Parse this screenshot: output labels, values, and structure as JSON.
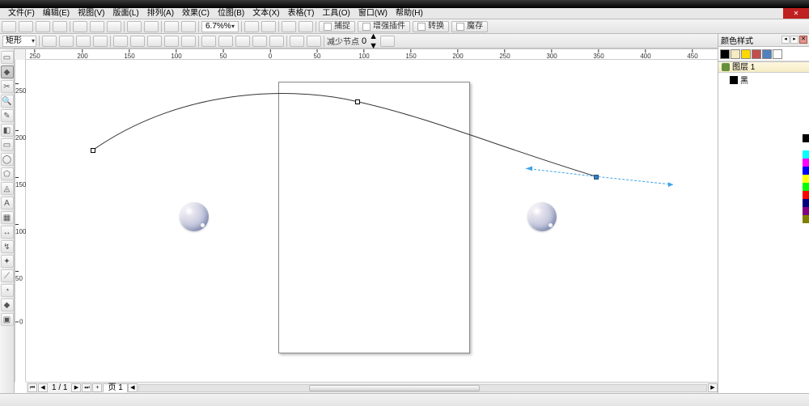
{
  "menu": {
    "items": [
      "文件(F)",
      "编辑(E)",
      "视图(V)",
      "版面(L)",
      "排列(A)",
      "效果(C)",
      "位图(B)",
      "文本(X)",
      "表格(T)",
      "工具(O)",
      "窗口(W)",
      "帮助(H)"
    ]
  },
  "toolbar1": {
    "zoom": "6.7%%",
    "plugin1": "捕捉",
    "plugin2": "增强插件",
    "plugin3": "转换",
    "plugin4": "魔存"
  },
  "propbar": {
    "shape": "矩形",
    "label1": "减少节点",
    "val1": "0"
  },
  "ruler_top": [
    {
      "pos": 11,
      "label": "250"
    },
    {
      "pos": 70,
      "label": "200"
    },
    {
      "pos": 128,
      "label": "150"
    },
    {
      "pos": 186,
      "label": "100"
    },
    {
      "pos": 244,
      "label": "50"
    },
    {
      "pos": 302,
      "label": "0"
    },
    {
      "pos": 360,
      "label": "50"
    },
    {
      "pos": 418,
      "label": "100"
    },
    {
      "pos": 476,
      "label": "150"
    },
    {
      "pos": 534,
      "label": "200"
    },
    {
      "pos": 592,
      "label": "250"
    },
    {
      "pos": 650,
      "label": "300"
    },
    {
      "pos": 708,
      "label": "350"
    },
    {
      "pos": 766,
      "label": "400"
    },
    {
      "pos": 824,
      "label": "450"
    }
  ],
  "ruler_left": [
    {
      "pos": 34,
      "label": "250"
    },
    {
      "pos": 92,
      "label": "200"
    },
    {
      "pos": 150,
      "label": "150"
    },
    {
      "pos": 208,
      "label": "100"
    },
    {
      "pos": 266,
      "label": "50"
    },
    {
      "pos": 324,
      "label": "0"
    }
  ],
  "right_panel": {
    "title": "颜色样式",
    "section": "图层 1",
    "entry": "黑"
  },
  "pager": {
    "current": "1 / 1",
    "tab": "页 1"
  },
  "status": {
    "text": " "
  },
  "palette": [
    "#000000",
    "#ffffff",
    "#00ffff",
    "#ff00ff",
    "#0000ff",
    "#ffff00",
    "#00ff00",
    "#ff0000",
    "#000080",
    "#800080",
    "#808000"
  ]
}
